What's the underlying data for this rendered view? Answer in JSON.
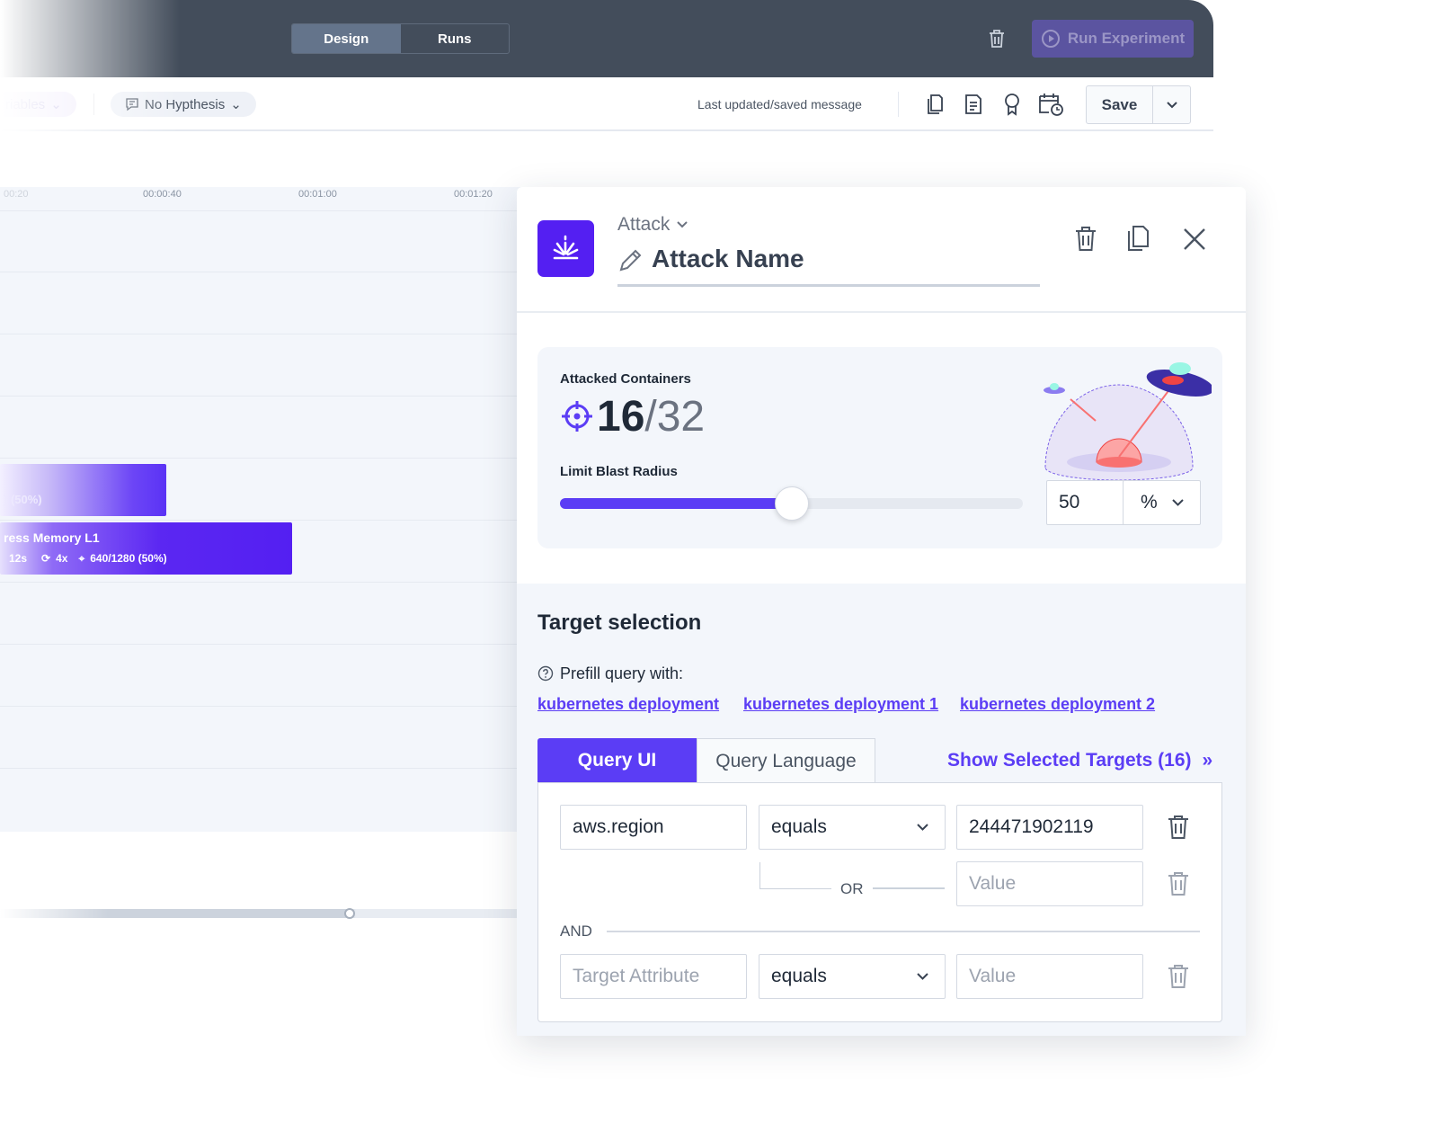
{
  "topbar": {
    "tabs": [
      {
        "label": "Design",
        "active": true
      },
      {
        "label": "Runs",
        "active": false
      }
    ],
    "run_button": "Run Experiment"
  },
  "toolbar": {
    "variables_label": "riables",
    "hypothesis_label": "No Hypthesis",
    "status_message": "Last updated/saved message",
    "save_label": "Save"
  },
  "timeline": {
    "ticks": [
      "00:20",
      "00:00:40",
      "00:01:00",
      "00:01:20"
    ],
    "bars": [
      {
        "title": "",
        "meta": ") (50%)"
      },
      {
        "title": "ress Memory L1",
        "duration": "12s",
        "repeat": "4x",
        "targets": "640/1280 (50%)"
      }
    ]
  },
  "panel": {
    "type_label": "Attack",
    "name": "Attack Name",
    "attacked_label": "Attacked Containers",
    "attacked_count": "16",
    "attacked_total": "/32",
    "blast_label": "Limit Blast Radius",
    "blast_value": "50",
    "blast_unit": "%",
    "blast_fraction": 0.5,
    "target_title": "Target selection",
    "prefill_label": "Prefill query with:",
    "prefill_links": [
      "kubernetes deployment",
      "kubernetes deployment 1",
      "kubernetes deployment 2"
    ],
    "query_tabs": [
      {
        "label": "Query UI",
        "active": true
      },
      {
        "label": "Query Language",
        "active": false
      }
    ],
    "show_targets": "Show Selected Targets (16)",
    "rows": [
      {
        "attribute": "aws.region",
        "operator": "equals",
        "value": "244471902119"
      }
    ],
    "or_label": "OR",
    "or_value_placeholder": "Value",
    "and_label": "AND",
    "attr_placeholder": "Target Attribute",
    "operator2": "equals",
    "value_placeholder": "Value"
  },
  "colors": {
    "accent": "#5b3df5",
    "topbar": "#434d5b",
    "bar": "#541ff2"
  }
}
